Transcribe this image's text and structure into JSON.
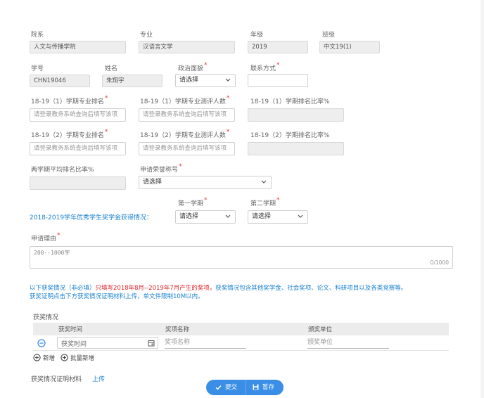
{
  "labels": {
    "college": "院系",
    "major": "专业",
    "grade": "年级",
    "class": "班级",
    "student_id": "学号",
    "name": "姓名",
    "political_status": "政治面貌",
    "contact": "联系方式",
    "rank1": "18-19（1）学期专业排名",
    "count1": "18-19（1）学期专业测评人数",
    "ratio1": "18-19（1）学期排名比率%",
    "rank2": "18-19（2）学期专业排名",
    "count2": "18-19（2）学期专业测评人数",
    "ratio2": "18-19（2）学期排名比率%",
    "avg_ratio": "两学期平均排名比率%",
    "honor": "申请荣誉称号",
    "sem1": "第一学期",
    "sem2": "第二学期",
    "scholarship_prompt": "2018-2019学年优秀学生奖学金获得情况：",
    "reason": "申请理由",
    "awards_title": "获奖情况",
    "proof": "获奖情况证明材料"
  },
  "values": {
    "college": "人文与传播学院",
    "major": "汉语言文学",
    "grade": "2019",
    "class": "中文19(1)",
    "student_id": "CHN19046",
    "name": "朱翔宇",
    "political_status": "请选择",
    "honor": "请选择",
    "sem1": "请选择",
    "sem2": "请选择",
    "reason_placeholder": "200--1000字",
    "reason_counter": "0/1000"
  },
  "placeholders": {
    "rank_hint": "请登录教务系统查询后填写该项"
  },
  "notice": {
    "prefix": "以下获奖情况（非必填）",
    "red_part": "只填写2018年8月--2019年7月产生的奖项，",
    "suffix": "获奖情况包含其他奖学金、社会奖项、论文、科研项目以及各类竞赛等。",
    "line2": "获奖证明点击下方获奖情况证明材料上传，单文件限制10M以内。"
  },
  "awards_table": {
    "headers": [
      "获奖时间",
      "奖项名称",
      "颁奖单位"
    ],
    "row": {
      "time": "获奖时间",
      "name": "奖项名称",
      "unit": "颁奖单位"
    }
  },
  "actions": {
    "add": "新增",
    "batch_add": "批量新增",
    "upload": "上传",
    "submit": "提交",
    "save_draft": "暂存"
  },
  "colors": {
    "accent": "#3a8ee6",
    "required": "#e33333",
    "notice_blue": "#1a82d1",
    "notice_red": "#e0262b"
  }
}
